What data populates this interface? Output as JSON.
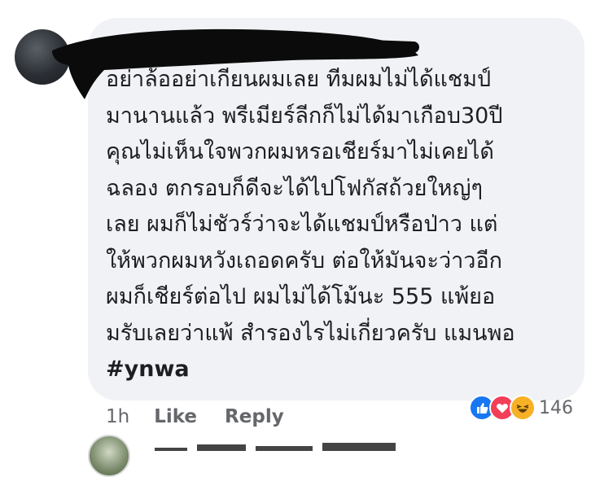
{
  "comment": {
    "lines": [
      "อย่าล้ออย่าเกียนผมเลย ทีมผมไม่ได้แชมป์",
      "มานานแล้ว พรีเมียร์ลีกก็ไม่ได้มาเกือบ30ปี",
      "คุณไม่เห็นใจพวกผมหรอเชียร์มาไม่เคยได้",
      "ฉลอง ตกรอบก็ดีจะได้ไปโฟกัสถ้วยใหญ่ๆ",
      "เลย ผมก็ไม่ชัวร์ว่าจะได้แชมป์หรือป่าว แต่",
      "ให้พวกผมหวังเถอดครับ ต่อให้มันจะว่าวอีก",
      "ผมก็เชียร์ต่อไป ผมไม่ได้โม้นะ 555 แพ้ยอ",
      "มรับเลยว่าแพ้ สำรองไรไม่เกี่ยวครับ แมนพอ"
    ],
    "hashtag": "#ynwa"
  },
  "actions": {
    "time": "1h",
    "like_label": "Like",
    "reply_label": "Reply"
  },
  "reactions": {
    "icons": [
      "like-icon",
      "love-icon",
      "haha-icon"
    ],
    "count": "146",
    "colors": {
      "like": "#1877f2",
      "love": "#f33e58",
      "haha": "#f7b125"
    }
  }
}
